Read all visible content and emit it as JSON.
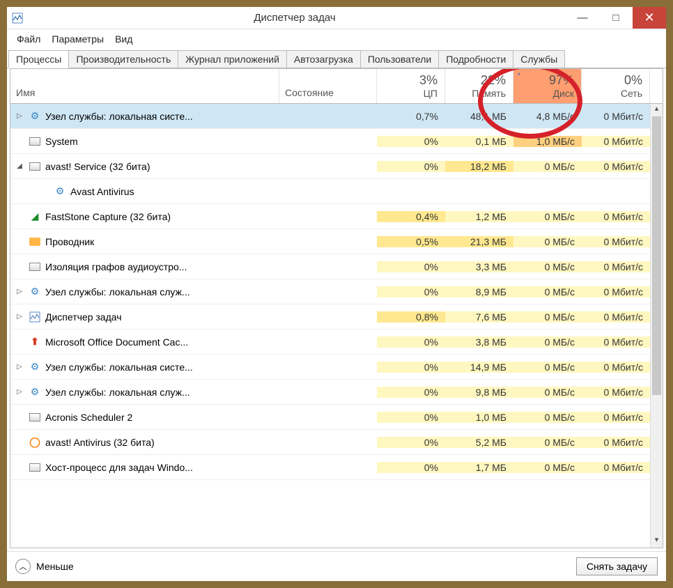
{
  "window": {
    "title": "Диспетчер задач"
  },
  "menu": {
    "file": "Файл",
    "options": "Параметры",
    "view": "Вид"
  },
  "tabs": {
    "processes": "Процессы",
    "performance": "Производительность",
    "history": "Журнал приложений",
    "startup": "Автозагрузка",
    "users": "Пользователи",
    "details": "Подробности",
    "services": "Службы"
  },
  "columns": {
    "name": "Имя",
    "state": "Состояние",
    "cpu_pct": "3%",
    "cpu_lbl": "ЦП",
    "mem_pct": "22%",
    "mem_lbl": "Память",
    "disk_pct": "97%",
    "disk_lbl": "Диск",
    "net_pct": "0%",
    "net_lbl": "Сеть"
  },
  "rows": [
    {
      "a": "▷",
      "i": "gear",
      "name": "Узел службы: локальная систе...",
      "cpu": "0,7%",
      "mem": "48,1 МБ",
      "disk": "4,8 МБ/с",
      "net": "0 Мбит/с",
      "sel": true
    },
    {
      "a": "",
      "i": "sys",
      "name": "System",
      "cpu": "0%",
      "mem": "0,1 МБ",
      "disk": "1,0 МБ/с",
      "net": "0 Мбит/с"
    },
    {
      "a": "◢",
      "i": "sys",
      "name": "avast! Service (32 бита)",
      "cpu": "0%",
      "mem": "18,2 МБ",
      "disk": "0 МБ/с",
      "net": "0 Мбит/с"
    },
    {
      "a": "",
      "i": "gear",
      "name": "Avast Antivirus",
      "cpu": "",
      "mem": "",
      "disk": "",
      "net": "",
      "child": true
    },
    {
      "a": "",
      "i": "fast",
      "name": "FastStone Capture (32 бита)",
      "cpu": "0,4%",
      "mem": "1,2 МБ",
      "disk": "0 МБ/с",
      "net": "0 Мбит/с"
    },
    {
      "a": "",
      "i": "exp",
      "name": "Проводник",
      "cpu": "0,5%",
      "mem": "21,3 МБ",
      "disk": "0 МБ/с",
      "net": "0 Мбит/с"
    },
    {
      "a": "",
      "i": "sys",
      "name": "Изоляция графов аудиоустро...",
      "cpu": "0%",
      "mem": "3,3 МБ",
      "disk": "0 МБ/с",
      "net": "0 Мбит/с"
    },
    {
      "a": "▷",
      "i": "gear",
      "name": "Узел службы: локальная служ...",
      "cpu": "0%",
      "mem": "8,9 МБ",
      "disk": "0 МБ/с",
      "net": "0 Мбит/с"
    },
    {
      "a": "▷",
      "i": "tm",
      "name": "Диспетчер задач",
      "cpu": "0,8%",
      "mem": "7,6 МБ",
      "disk": "0 МБ/с",
      "net": "0 Мбит/с"
    },
    {
      "a": "",
      "i": "off",
      "name": "Microsoft Office Document Cac...",
      "cpu": "0%",
      "mem": "3,8 МБ",
      "disk": "0 МБ/с",
      "net": "0 Мбит/с"
    },
    {
      "a": "▷",
      "i": "gear",
      "name": "Узел службы: локальная систе...",
      "cpu": "0%",
      "mem": "14,9 МБ",
      "disk": "0 МБ/с",
      "net": "0 Мбит/с"
    },
    {
      "a": "▷",
      "i": "gear",
      "name": "Узел службы: локальная служ...",
      "cpu": "0%",
      "mem": "9,8 МБ",
      "disk": "0 МБ/с",
      "net": "0 Мбит/с"
    },
    {
      "a": "",
      "i": "sys",
      "name": "Acronis Scheduler 2",
      "cpu": "0%",
      "mem": "1,0 МБ",
      "disk": "0 МБ/с",
      "net": "0 Мбит/с"
    },
    {
      "a": "",
      "i": "av",
      "name": "avast! Antivirus (32 бита)",
      "cpu": "0%",
      "mem": "5,2 МБ",
      "disk": "0 МБ/с",
      "net": "0 Мбит/с"
    },
    {
      "a": "",
      "i": "sys",
      "name": "Хост-процесс для задач Windo...",
      "cpu": "0%",
      "mem": "1,7 МБ",
      "disk": "0 МБ/с",
      "net": "0 Мбит/с"
    }
  ],
  "footer": {
    "fewer": "Меньше",
    "endtask": "Снять задачу"
  }
}
